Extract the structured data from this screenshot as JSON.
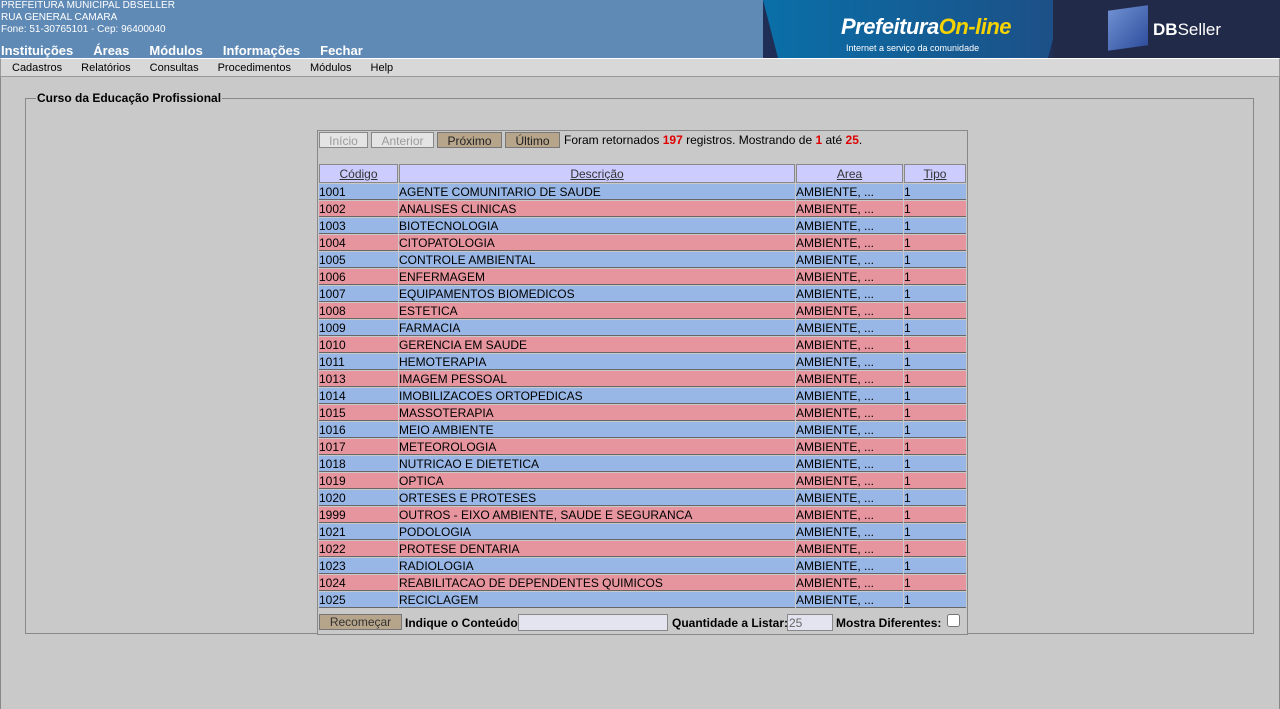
{
  "header": {
    "org_lines": [
      "PREFEITURA MUNICIPAL DBSELLER",
      "RUA GENERAL CAMARA",
      "Fone: 51-30765101  -  Cep: 96400040"
    ],
    "menu": [
      "Instituições",
      "Áreas",
      "Módulos",
      "Informações",
      "Fechar"
    ],
    "banner": {
      "brand_a": "Prefeitura",
      "brand_b": "On-line",
      "tagline": "Internet a serviço da comunidade",
      "brand2_a": "DB",
      "brand2_b": "Seller"
    }
  },
  "submenu": [
    "Cadastros",
    "Relatórios",
    "Consultas",
    "Procedimentos",
    "Módulos",
    "Help"
  ],
  "panel": {
    "legend": "Curso da Educação Profissional"
  },
  "nav": {
    "inicio": "Início",
    "anterior": "Anterior",
    "proximo": "Próximo",
    "ultimo": "Último",
    "text_a": "Foram retornados ",
    "total": "197",
    "text_b": " registros. Mostrando de ",
    "from": "1",
    "text_c": " até ",
    "to": "25",
    "text_d": "."
  },
  "columns": [
    "Código",
    "Descrição",
    "Area",
    "Tipo"
  ],
  "rows": [
    [
      "1001",
      "AGENTE COMUNITARIO DE SAUDE",
      "AMBIENTE, ...",
      "1"
    ],
    [
      "1002",
      "ANALISES CLINICAS",
      "AMBIENTE, ...",
      "1"
    ],
    [
      "1003",
      "BIOTECNOLOGIA",
      "AMBIENTE, ...",
      "1"
    ],
    [
      "1004",
      "CITOPATOLOGIA",
      "AMBIENTE, ...",
      "1"
    ],
    [
      "1005",
      "CONTROLE AMBIENTAL",
      "AMBIENTE, ...",
      "1"
    ],
    [
      "1006",
      "ENFERMAGEM",
      "AMBIENTE, ...",
      "1"
    ],
    [
      "1007",
      "EQUIPAMENTOS BIOMEDICOS",
      "AMBIENTE, ...",
      "1"
    ],
    [
      "1008",
      "ESTETICA",
      "AMBIENTE, ...",
      "1"
    ],
    [
      "1009",
      "FARMACIA",
      "AMBIENTE, ...",
      "1"
    ],
    [
      "1010",
      "GERENCIA EM SAUDE",
      "AMBIENTE, ...",
      "1"
    ],
    [
      "1011",
      "HEMOTERAPIA",
      "AMBIENTE, ...",
      "1"
    ],
    [
      "1013",
      "IMAGEM PESSOAL",
      "AMBIENTE, ...",
      "1"
    ],
    [
      "1014",
      "IMOBILIZACOES ORTOPEDICAS",
      "AMBIENTE, ...",
      "1"
    ],
    [
      "1015",
      "MASSOTERAPIA",
      "AMBIENTE, ...",
      "1"
    ],
    [
      "1016",
      "MEIO AMBIENTE",
      "AMBIENTE, ...",
      "1"
    ],
    [
      "1017",
      "METEOROLOGIA",
      "AMBIENTE, ...",
      "1"
    ],
    [
      "1018",
      "NUTRICAO E DIETETICA",
      "AMBIENTE, ...",
      "1"
    ],
    [
      "1019",
      "OPTICA",
      "AMBIENTE, ...",
      "1"
    ],
    [
      "1020",
      "ORTESES E PROTESES",
      "AMBIENTE, ...",
      "1"
    ],
    [
      "1999",
      "OUTROS - EIXO AMBIENTE, SAUDE E SEGURANCA",
      "AMBIENTE, ...",
      "1"
    ],
    [
      "1021",
      "PODOLOGIA",
      "AMBIENTE, ...",
      "1"
    ],
    [
      "1022",
      "PROTESE DENTARIA",
      "AMBIENTE, ...",
      "1"
    ],
    [
      "1023",
      "RADIOLOGIA",
      "AMBIENTE, ...",
      "1"
    ],
    [
      "1024",
      "REABILITACAO DE DEPENDENTES QUIMICOS",
      "AMBIENTE, ...",
      "1"
    ],
    [
      "1025",
      "RECICLAGEM",
      "AMBIENTE, ...",
      "1"
    ]
  ],
  "footer": {
    "recomecar": "Recomeçar",
    "conteudo_label": "Indique o Conteúdo:",
    "conteudo_value": "",
    "qtd_label": "Quantidade a Listar:",
    "qtd_value": "25",
    "mostra_label": "Mostra Diferentes:"
  },
  "colors": {
    "row_odd": "#98b7e6",
    "row_even": "#e6959e",
    "header_blue": "#5f8ab5",
    "col_header": "#ccccff",
    "accent_red": "#e00000"
  }
}
